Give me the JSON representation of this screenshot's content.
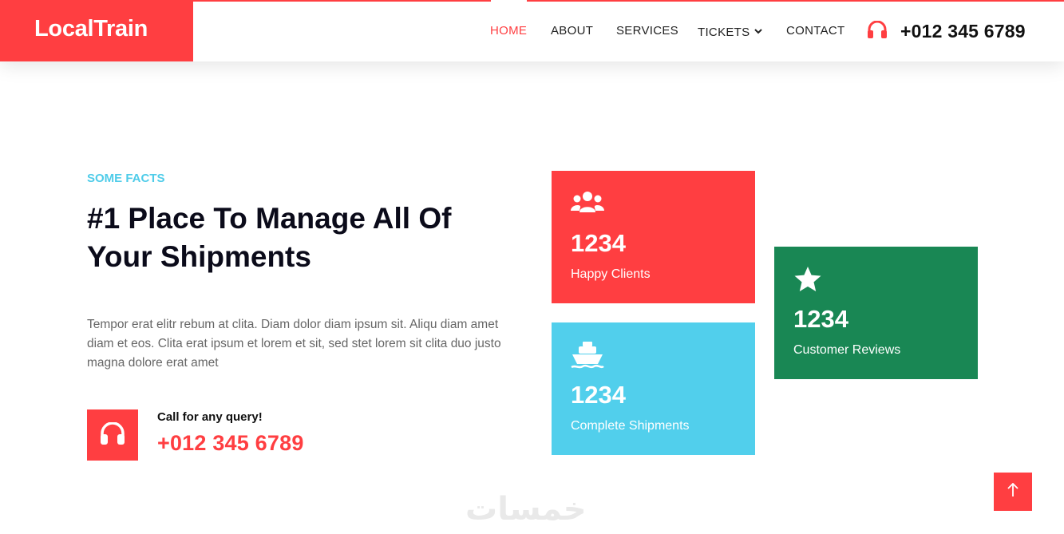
{
  "brand": {
    "name": "LocalTrain"
  },
  "nav": {
    "items": [
      {
        "label": "HOME",
        "active": true
      },
      {
        "label": "ABOUT"
      },
      {
        "label": "SERVICES"
      },
      {
        "label": "TICKETS"
      },
      {
        "label": "CONTACT"
      }
    ],
    "phone": "+012 345 6789",
    "phone_icon": "headphones-icon"
  },
  "facts": {
    "eyebrow": "SOME FACTS",
    "headline": "#1 Place To Manage All Of Your Shipments",
    "paragraph": "Tempor erat elitr rebum at clita. Diam dolor diam ipsum sit. Aliqu diam amet diam et eos. Clita erat ipsum et lorem et sit, sed stet lorem sit clita duo justo magna dolore erat amet",
    "call_label": "Call for any query!",
    "call_number": "+012 345 6789",
    "call_icon": "headphones-icon"
  },
  "cards": [
    {
      "icon": "users-icon",
      "value": "1234",
      "label": "Happy Clients",
      "color": "#ff3e41"
    },
    {
      "icon": "ship-icon",
      "value": "1234",
      "label": "Complete Shipments",
      "color": "#51cfec"
    },
    {
      "icon": "star-icon",
      "value": "1234",
      "label": "Customer Reviews",
      "color": "#198754"
    }
  ],
  "back_to_top_icon": "arrow-up-icon",
  "watermark": "خمسات",
  "colors": {
    "primary": "#ff3e41",
    "accent": "#4fcce9",
    "success": "#198754"
  }
}
